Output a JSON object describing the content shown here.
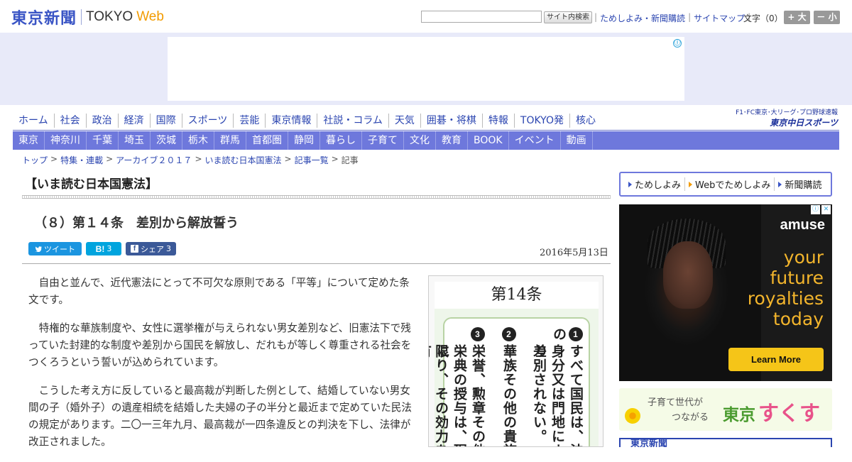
{
  "header": {
    "logo_jp": "東京新聞",
    "logo_tokyo": "TOKYO",
    "logo_web": "Web",
    "search_button": "サイト内検索",
    "links": [
      "ためしよみ・新聞購読",
      "サイトマップ"
    ],
    "font_size_label": "文字（0）",
    "font_large": "+ 大",
    "font_small": "－ 小"
  },
  "ad": {
    "info_icon": "ⓘ"
  },
  "global_nav": [
    "ホーム",
    "社会",
    "政治",
    "経済",
    "国際",
    "スポーツ",
    "芸能",
    "東京情報",
    "社説・コラム",
    "天気",
    "囲碁・将棋",
    "特報",
    "TOKYO発",
    "核心"
  ],
  "promo": {
    "line1": "F1･FC東京･大リーグ･プロ野球速報",
    "line2": "東京中日スポーツ"
  },
  "regional_nav": [
    "東京",
    "神奈川",
    "千葉",
    "埼玉",
    "茨城",
    "栃木",
    "群馬",
    "首都圏",
    "静岡",
    "暮らし",
    "子育て",
    "文化",
    "教育",
    "BOOK",
    "イベント",
    "動画"
  ],
  "breadcrumb": [
    "トップ",
    "特集・連載",
    "アーカイブ２０１７",
    "いま読む日本国憲法",
    "記事一覧",
    "記事"
  ],
  "series_title": "【いま読む日本国憲法】",
  "article": {
    "title": "（８）第１４条　差別から解放誓う",
    "date": "2016年5月13日",
    "social": {
      "tweet": "ツイート",
      "hatena_icon": "B!",
      "hatena_count": "3",
      "share": "シェア",
      "share_count": "3"
    },
    "paragraphs": [
      "自由と並んで、近代憲法にとって不可欠な原則である「平等」について定めた条文です。",
      "特権的な華族制度や、女性に選挙権が与えられない男女差別など、旧憲法下で残っていた封建的な制度や差別から国民を解放し、だれもが等しく尊重される社会をつくろうという誓いが込められています。",
      "こうした考え方に反していると最高裁が判断した例として、結婚していない男女間の子（婚外子）の遺産相続を結婚した夫婦の子の半分と最近まで定めていた民法の規定があります。二〇一三年九月、最高裁が一四条違反との判決を下し、法律が改正されました。"
    ],
    "image": {
      "title": "第14条",
      "col1_num": "1",
      "col1_a": "すべて国民は、法の",
      "col1_b": "身分又は門地により",
      "col1_c": "差別されない。",
      "col2_num": "2",
      "col2_a": "華族その他の貴族",
      "col3_num": "3",
      "col3_a": "栄誉、勲章その他",
      "col3_b": "栄典の授与は、現に",
      "col3_c": "限り、その効力を有"
    }
  },
  "sidebar": {
    "links": [
      "ためしよみ",
      "Webでためしよみ",
      "新聞購読"
    ],
    "ad": {
      "brand": "amuse",
      "slogan": "your future royalties today",
      "cta": "Learn More"
    },
    "sukusuku": {
      "line1": "子育て世代が",
      "line2": "つながる",
      "tokyo": "東京",
      "name": "すくすく"
    },
    "bottom_banner": "東京新聞"
  }
}
